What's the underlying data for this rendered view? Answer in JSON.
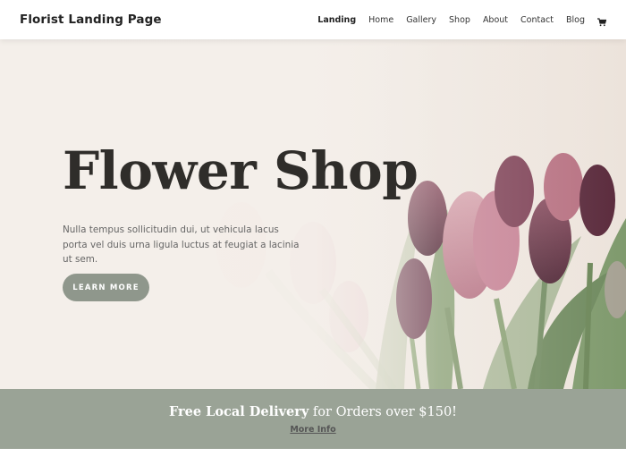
{
  "site": {
    "title": "Florist Landing Page"
  },
  "nav": {
    "items": [
      "Landing",
      "Home",
      "Gallery",
      "Shop",
      "About",
      "Contact",
      "Blog"
    ],
    "active": "Landing",
    "cart_icon": "cart-icon"
  },
  "hero": {
    "title": "Flower Shop",
    "description": "Nulla tempus sollicitudin dui, ut vehicula lacus porta vel duis urna ligula luctus at feugiat a lacinia ut sem.",
    "button_label": "LEARN MORE"
  },
  "banner": {
    "bold_text": "Free Local Delivery",
    "rest_text": " for Orders over $150!",
    "link_label": "More Info"
  },
  "colors": {
    "hero_bg": "#f4efea",
    "button": "#8f978c",
    "banner": "#9aa396",
    "tulip_pink": "#c98a98",
    "tulip_purple": "#6d3b4c",
    "stem_green": "#8fa57c"
  }
}
